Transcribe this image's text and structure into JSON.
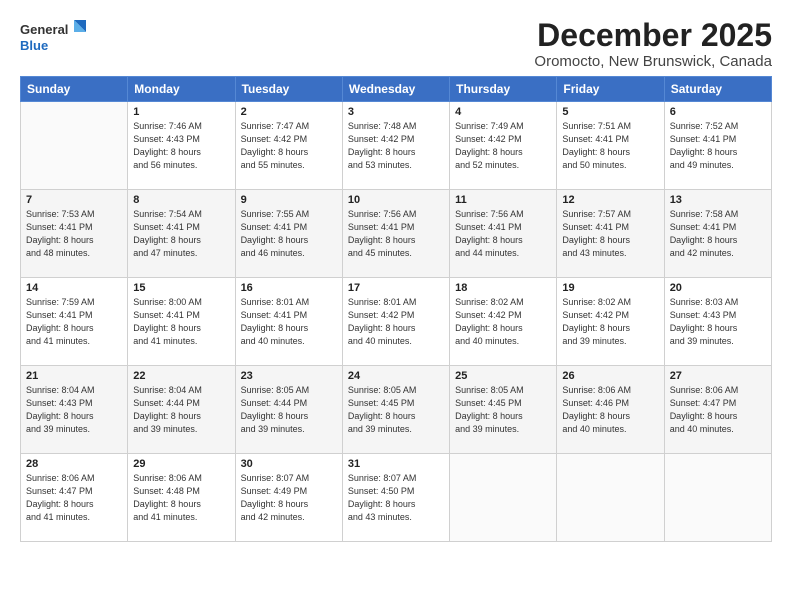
{
  "logo": {
    "line1": "General",
    "line2": "Blue"
  },
  "title": "December 2025",
  "subtitle": "Oromocto, New Brunswick, Canada",
  "days_of_week": [
    "Sunday",
    "Monday",
    "Tuesday",
    "Wednesday",
    "Thursday",
    "Friday",
    "Saturday"
  ],
  "weeks": [
    [
      {
        "day": "",
        "info": ""
      },
      {
        "day": "1",
        "info": "Sunrise: 7:46 AM\nSunset: 4:43 PM\nDaylight: 8 hours\nand 56 minutes."
      },
      {
        "day": "2",
        "info": "Sunrise: 7:47 AM\nSunset: 4:42 PM\nDaylight: 8 hours\nand 55 minutes."
      },
      {
        "day": "3",
        "info": "Sunrise: 7:48 AM\nSunset: 4:42 PM\nDaylight: 8 hours\nand 53 minutes."
      },
      {
        "day": "4",
        "info": "Sunrise: 7:49 AM\nSunset: 4:42 PM\nDaylight: 8 hours\nand 52 minutes."
      },
      {
        "day": "5",
        "info": "Sunrise: 7:51 AM\nSunset: 4:41 PM\nDaylight: 8 hours\nand 50 minutes."
      },
      {
        "day": "6",
        "info": "Sunrise: 7:52 AM\nSunset: 4:41 PM\nDaylight: 8 hours\nand 49 minutes."
      }
    ],
    [
      {
        "day": "7",
        "info": "Sunrise: 7:53 AM\nSunset: 4:41 PM\nDaylight: 8 hours\nand 48 minutes."
      },
      {
        "day": "8",
        "info": "Sunrise: 7:54 AM\nSunset: 4:41 PM\nDaylight: 8 hours\nand 47 minutes."
      },
      {
        "day": "9",
        "info": "Sunrise: 7:55 AM\nSunset: 4:41 PM\nDaylight: 8 hours\nand 46 minutes."
      },
      {
        "day": "10",
        "info": "Sunrise: 7:56 AM\nSunset: 4:41 PM\nDaylight: 8 hours\nand 45 minutes."
      },
      {
        "day": "11",
        "info": "Sunrise: 7:56 AM\nSunset: 4:41 PM\nDaylight: 8 hours\nand 44 minutes."
      },
      {
        "day": "12",
        "info": "Sunrise: 7:57 AM\nSunset: 4:41 PM\nDaylight: 8 hours\nand 43 minutes."
      },
      {
        "day": "13",
        "info": "Sunrise: 7:58 AM\nSunset: 4:41 PM\nDaylight: 8 hours\nand 42 minutes."
      }
    ],
    [
      {
        "day": "14",
        "info": "Sunrise: 7:59 AM\nSunset: 4:41 PM\nDaylight: 8 hours\nand 41 minutes."
      },
      {
        "day": "15",
        "info": "Sunrise: 8:00 AM\nSunset: 4:41 PM\nDaylight: 8 hours\nand 41 minutes."
      },
      {
        "day": "16",
        "info": "Sunrise: 8:01 AM\nSunset: 4:41 PM\nDaylight: 8 hours\nand 40 minutes."
      },
      {
        "day": "17",
        "info": "Sunrise: 8:01 AM\nSunset: 4:42 PM\nDaylight: 8 hours\nand 40 minutes."
      },
      {
        "day": "18",
        "info": "Sunrise: 8:02 AM\nSunset: 4:42 PM\nDaylight: 8 hours\nand 40 minutes."
      },
      {
        "day": "19",
        "info": "Sunrise: 8:02 AM\nSunset: 4:42 PM\nDaylight: 8 hours\nand 39 minutes."
      },
      {
        "day": "20",
        "info": "Sunrise: 8:03 AM\nSunset: 4:43 PM\nDaylight: 8 hours\nand 39 minutes."
      }
    ],
    [
      {
        "day": "21",
        "info": "Sunrise: 8:04 AM\nSunset: 4:43 PM\nDaylight: 8 hours\nand 39 minutes."
      },
      {
        "day": "22",
        "info": "Sunrise: 8:04 AM\nSunset: 4:44 PM\nDaylight: 8 hours\nand 39 minutes."
      },
      {
        "day": "23",
        "info": "Sunrise: 8:05 AM\nSunset: 4:44 PM\nDaylight: 8 hours\nand 39 minutes."
      },
      {
        "day": "24",
        "info": "Sunrise: 8:05 AM\nSunset: 4:45 PM\nDaylight: 8 hours\nand 39 minutes."
      },
      {
        "day": "25",
        "info": "Sunrise: 8:05 AM\nSunset: 4:45 PM\nDaylight: 8 hours\nand 39 minutes."
      },
      {
        "day": "26",
        "info": "Sunrise: 8:06 AM\nSunset: 4:46 PM\nDaylight: 8 hours\nand 40 minutes."
      },
      {
        "day": "27",
        "info": "Sunrise: 8:06 AM\nSunset: 4:47 PM\nDaylight: 8 hours\nand 40 minutes."
      }
    ],
    [
      {
        "day": "28",
        "info": "Sunrise: 8:06 AM\nSunset: 4:47 PM\nDaylight: 8 hours\nand 41 minutes."
      },
      {
        "day": "29",
        "info": "Sunrise: 8:06 AM\nSunset: 4:48 PM\nDaylight: 8 hours\nand 41 minutes."
      },
      {
        "day": "30",
        "info": "Sunrise: 8:07 AM\nSunset: 4:49 PM\nDaylight: 8 hours\nand 42 minutes."
      },
      {
        "day": "31",
        "info": "Sunrise: 8:07 AM\nSunset: 4:50 PM\nDaylight: 8 hours\nand 43 minutes."
      },
      {
        "day": "",
        "info": ""
      },
      {
        "day": "",
        "info": ""
      },
      {
        "day": "",
        "info": ""
      }
    ]
  ]
}
